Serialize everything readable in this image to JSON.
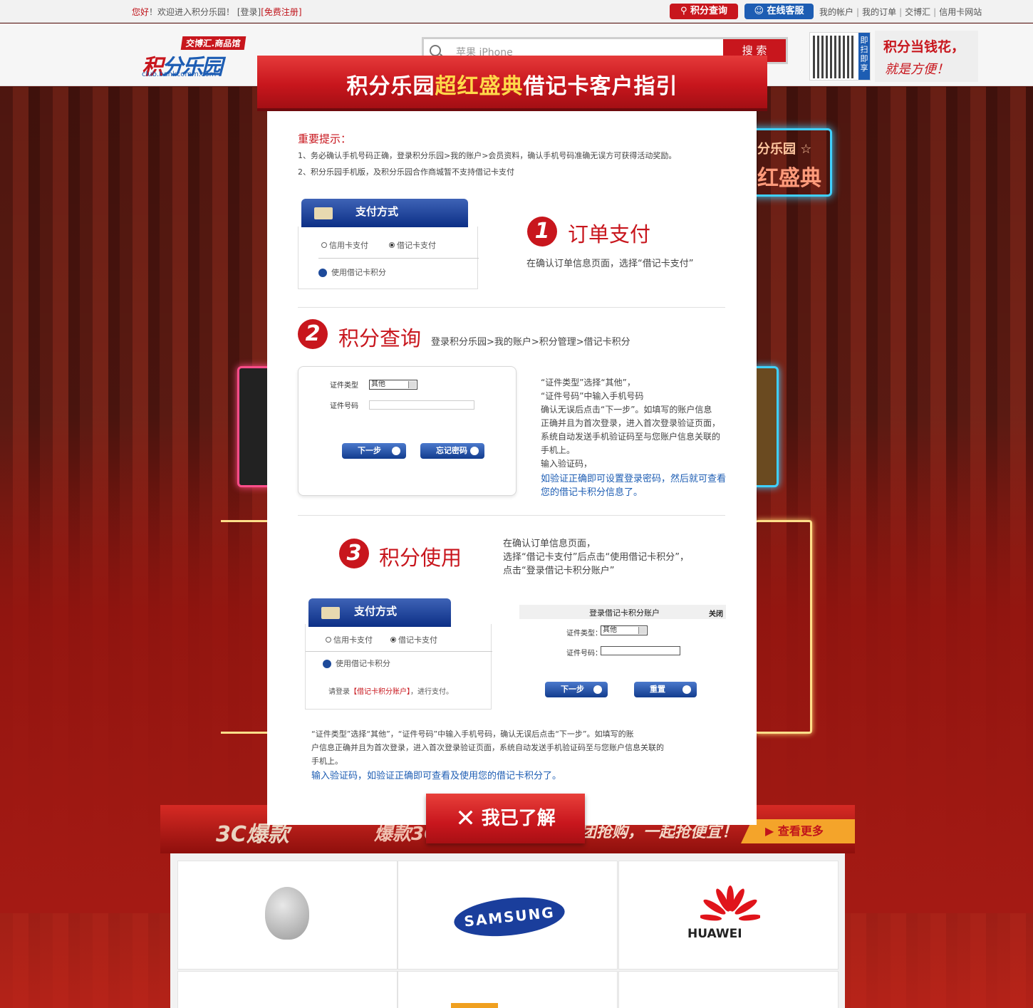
{
  "topbar": {
    "greeting": "您好",
    "welcome": "！欢迎进入积分乐园！",
    "login": "[登录]",
    "register": "[免费注册]",
    "query_btn": "积分查询",
    "service_btn": "在线客服",
    "links": [
      "我的帐户",
      "我的订单",
      "交博汇",
      "信用卡网站"
    ]
  },
  "header": {
    "logo_tag": "交博汇.商品馆",
    "logo_main_blue": "积",
    "logo_main_rest": "分乐园",
    "logo_url": "club.bankcomm.com",
    "search_placeholder": "苹果 iPhone",
    "search_btn": "搜 索",
    "qr_side": "即扫即享",
    "slogan_1": "积分当钱花，",
    "slogan_2": "就是方便！"
  },
  "stage": {
    "neon_1": "分乐园 ☆",
    "neon_2": "红盛典"
  },
  "modal": {
    "title_pre": "积分乐园",
    "title_hl": "超红盛典",
    "title_post": "借记卡客户指引",
    "tips_title": "重要提示：",
    "tips": [
      "1、务必确认手机号码正确，登录积分乐园>我的账户>会员资料，确认手机号码准确无误方可获得活动奖励。",
      "2、积分乐园手机版，及积分乐园合作商城暂不支持借记卡支付"
    ],
    "pay_tab": "支付方式",
    "credit_pay": "信用卡支付",
    "debit_pay": "借记卡支付",
    "use_debit_points": "使用借记卡积分",
    "step1": {
      "num": "1",
      "title": "订单支付",
      "desc": "在确认订单信息页面，选择“借记卡支付”"
    },
    "step2": {
      "num": "2",
      "title": "积分查询",
      "path": "登录积分乐园>我的账户>积分管理>借记卡积分"
    },
    "form": {
      "id_type_label": "证件类型",
      "id_type_value": "其他",
      "id_number_label": "证件号码",
      "next_btn": "下一步",
      "forgot_btn": "忘记密码"
    },
    "step2_desc": [
      "“证件类型”选择“其他”，",
      "“证件号码”中输入手机号码",
      "确认无误后点击“下一步”。如填写的账户信息",
      "正确并且为首次登录，进入首次登录验证页面，",
      "系统自动发送手机验证码至与您账户信息关联的",
      "手机上。",
      "输入验证码，"
    ],
    "step2_desc_blue": [
      "如验证正确即可设置登录密码，然后就可查看",
      "您的借记卡积分信息了。"
    ],
    "step3": {
      "num": "3",
      "title": "积分使用"
    },
    "step3_desc": [
      "在确认订单信息页面，",
      "选择“借记卡支付”后点击“使用借记卡积分”，",
      "点击“登录借记卡积分账户”"
    ],
    "login_hint_pre": "请登录",
    "login_hint_link": "【借记卡积分账户】",
    "login_hint_post": "，进行支付。",
    "login_panel": {
      "title": "登录借记卡积分账户",
      "close": "关闭",
      "id_type_label": "证件类型：",
      "id_type_value": "其他",
      "id_number_label": "证件号码：",
      "next_btn": "下一步",
      "reset_btn": "重置"
    },
    "bottom_desc": [
      "“证件类型”选择“其他”，“证件号码”中输入手机号码，确认无误后点击“下一步”。如填写的账",
      "户信息正确并且为首次登录，进入首次登录验证页面，系统自动发送手机验证码至与您账户信息关联的",
      "手机上。"
    ],
    "bottom_desc_blue": "输入验证码，如验证正确即可查看及使用您的借记卡积分了。",
    "close_btn": "我已了解"
  },
  "bottom": {
    "bar_t1": "3C爆款",
    "bar_t2": "爆款3C",
    "bar_t3": "团抢购，一起抢便宜！",
    "more": "查看更多",
    "brands": [
      "Apple",
      "SAMSUNG",
      "HUAWEI"
    ]
  }
}
